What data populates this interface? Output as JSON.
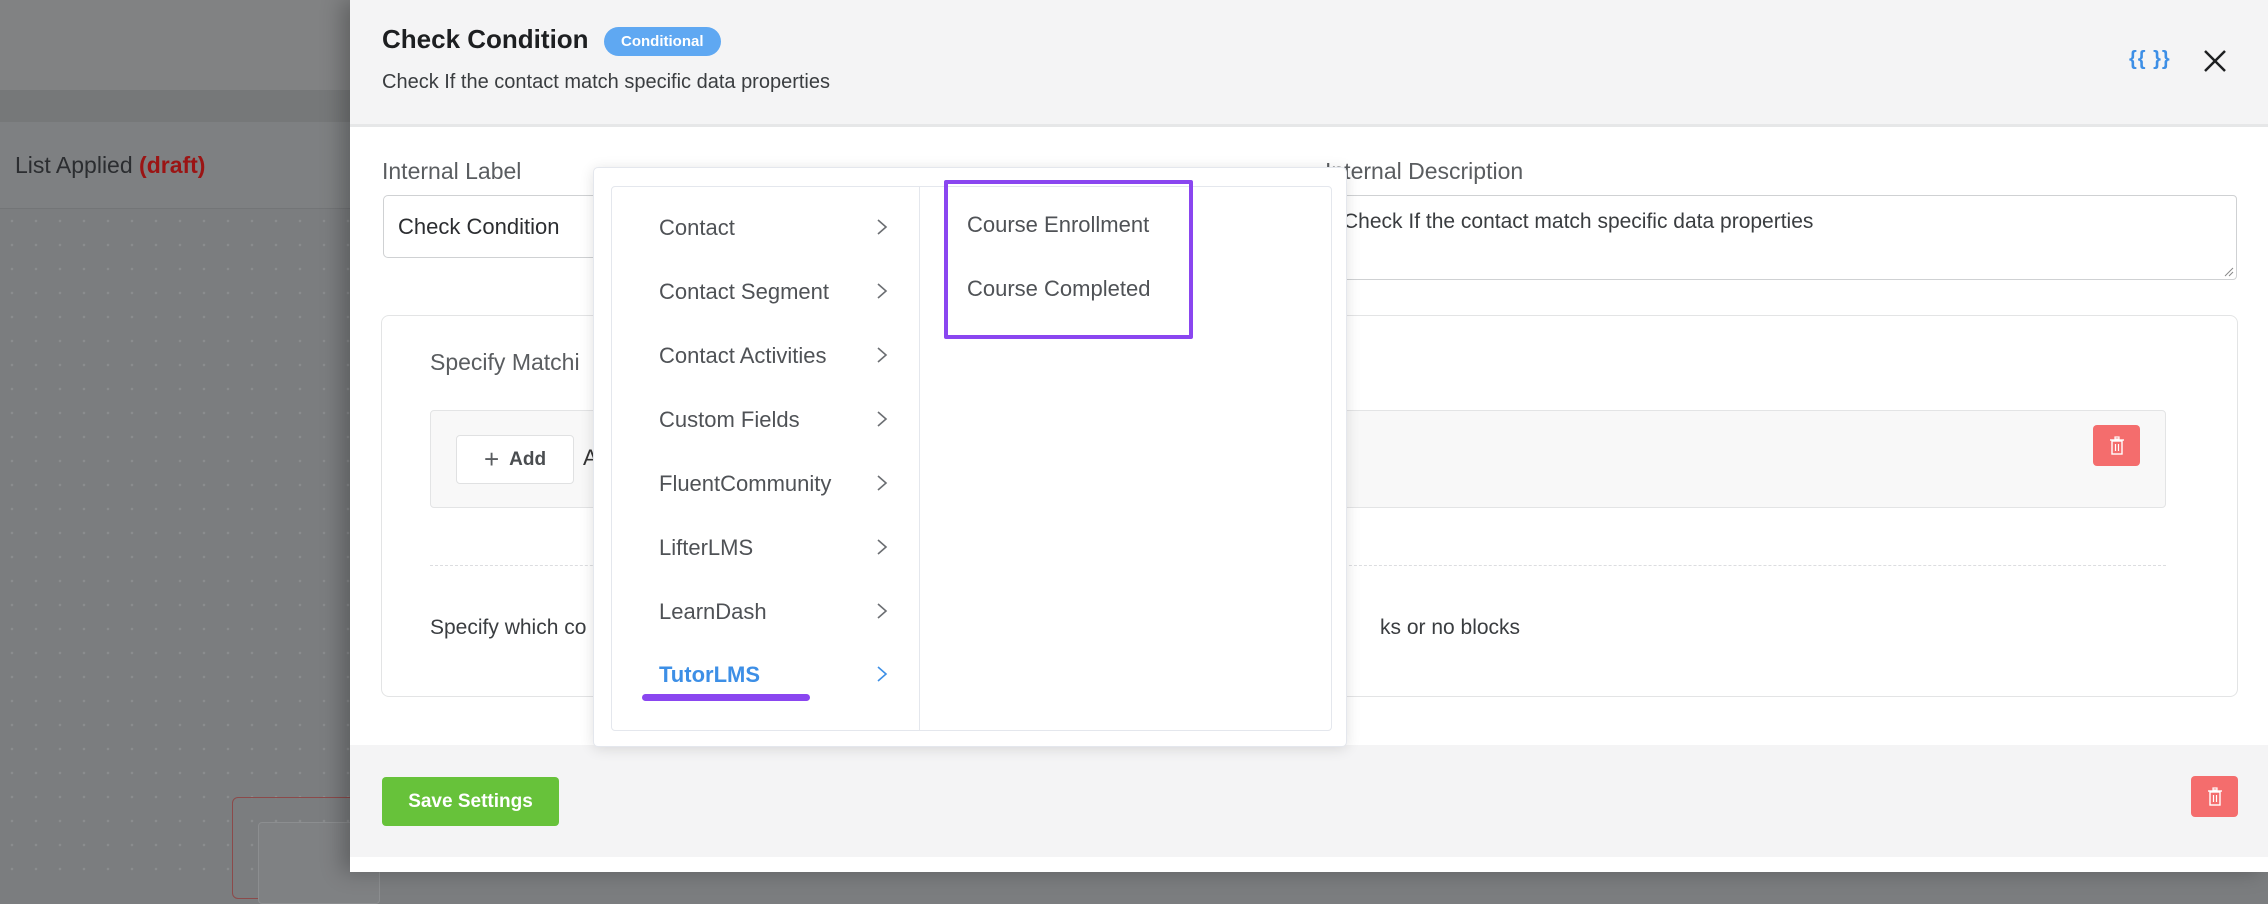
{
  "background": {
    "title": "List Applied",
    "status": "(draft)"
  },
  "drawer": {
    "title": "Check Condition",
    "badge": "Conditional",
    "subtitle": "Check If the contact match specific data properties",
    "smartcode_label": "{{ }}",
    "close_icon": "close-icon"
  },
  "form": {
    "internal_label": {
      "label": "Internal Label",
      "value": "Check Condition"
    },
    "internal_description": {
      "label": "Internal Description",
      "value": "Check If the contact match specific data properties"
    }
  },
  "matching": {
    "title_visible": "Specify Matchi",
    "add_button": "Add",
    "after_add_visible": "A",
    "help_text_start": "Specify which co",
    "help_text_end": "ks or no blocks",
    "delete_icon": "trash-icon"
  },
  "footer": {
    "save_button": "Save Settings",
    "delete_icon": "trash-icon"
  },
  "cascader": {
    "categories": [
      {
        "label": "Contact",
        "active": false
      },
      {
        "label": "Contact Segment",
        "active": false
      },
      {
        "label": "Contact Activities",
        "active": false
      },
      {
        "label": "Custom Fields",
        "active": false
      },
      {
        "label": "FluentCommunity",
        "active": false
      },
      {
        "label": "LifterLMS",
        "active": false
      },
      {
        "label": "LearnDash",
        "active": false
      },
      {
        "label": "TutorLMS",
        "active": true
      }
    ],
    "sub_options": [
      {
        "label": "Course Enrollment"
      },
      {
        "label": "Course Completed"
      }
    ]
  },
  "colors": {
    "accent_blue": "#3d8fe6",
    "badge_blue": "#5fa8f2",
    "highlight_purple": "#8a46f0",
    "save_green": "#67c23a",
    "danger_red": "#f46d6d",
    "draft_red": "#9b1414"
  }
}
